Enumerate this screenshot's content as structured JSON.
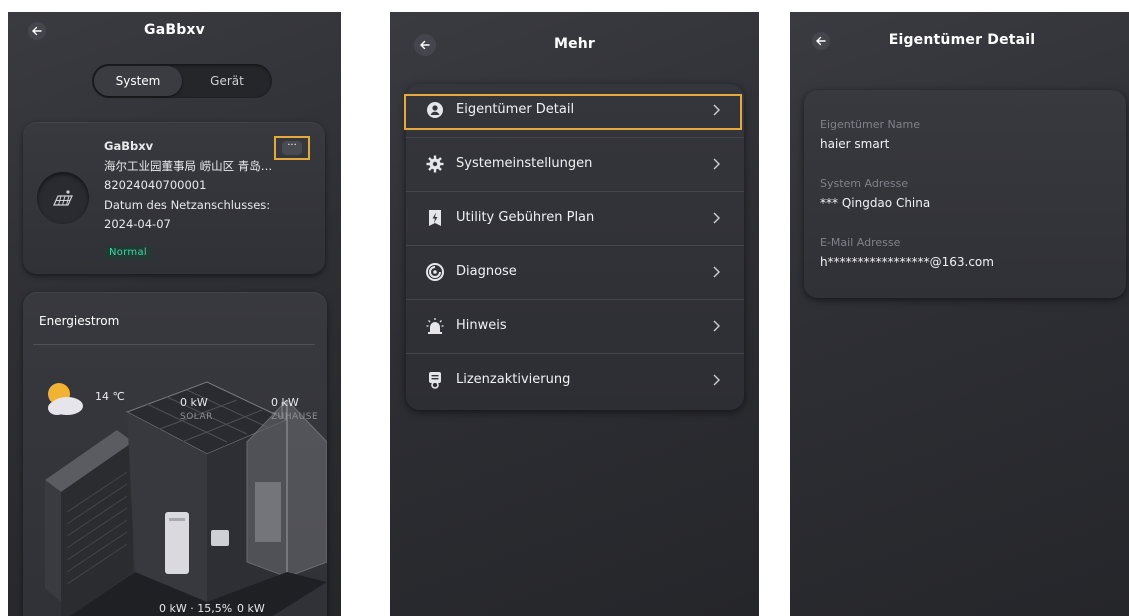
{
  "screen1": {
    "title": "GaBbxv",
    "segment": {
      "system": "System",
      "device": "Gerät"
    },
    "system_card": {
      "name": "GaBbxv",
      "address": "海尔工业园董事局 崂山区 青岛…",
      "serial": "82024040700001",
      "grid_label": "Datum des Netzanschlusses:",
      "grid_date": "2024-04-07",
      "status": "Normal",
      "more_label": "···"
    },
    "energy": {
      "title": "Energiestrom",
      "temperature": "14 ℃",
      "solar_value": "0 kW",
      "solar_label": "SOLAR",
      "home_value": "0 kW",
      "home_label": "ZUHAUSE",
      "battery_value": "0 kW · 15,5%",
      "grid_value": "0 kW"
    }
  },
  "screen2": {
    "title": "Mehr",
    "items": [
      {
        "label": "Eigentümer Detail",
        "icon": "person-icon"
      },
      {
        "label": "Systemeinstellungen",
        "icon": "gear-icon"
      },
      {
        "label": "Utility Gebühren Plan",
        "icon": "bolt-icon"
      },
      {
        "label": "Diagnose",
        "icon": "diagnose-icon"
      },
      {
        "label": "Hinweis",
        "icon": "alarm-icon"
      },
      {
        "label": "Lizenzaktivierung",
        "icon": "license-icon"
      }
    ]
  },
  "screen3": {
    "title": "Eigentümer Detail",
    "owner_label": "Eigentümer Name",
    "owner_value": "haier smart",
    "address_label": "System Adresse",
    "address_value": "*** Qingdao China",
    "email_label": "E-Mail Adresse",
    "email_value": "h*****************@163.com"
  },
  "colors": {
    "accent": "#e6a93b",
    "status": "#3fd3a0",
    "background": "#2e2f34"
  }
}
